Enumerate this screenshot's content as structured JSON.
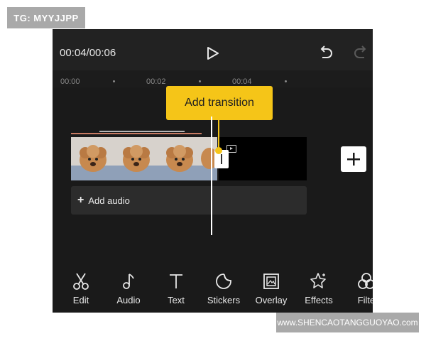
{
  "overlay_tag": "TG: MYYJJPP",
  "watermark": "www.SHENCAOTANGGUOYAO.com",
  "player": {
    "time": "00:04/00:06"
  },
  "ruler": {
    "ticks": [
      "00:00",
      "00:02",
      "00:04"
    ]
  },
  "tooltip": {
    "text": "Add transition"
  },
  "audio_track": {
    "label": "Add audio"
  },
  "toolbar": {
    "items": [
      {
        "label": "Edit",
        "icon": "scissors-icon"
      },
      {
        "label": "Audio",
        "icon": "music-note-icon"
      },
      {
        "label": "Text",
        "icon": "text-icon"
      },
      {
        "label": "Stickers",
        "icon": "sticker-icon"
      },
      {
        "label": "Overlay",
        "icon": "overlay-icon"
      },
      {
        "label": "Effects",
        "icon": "effects-icon"
      },
      {
        "label": "Filte",
        "icon": "filter-icon"
      }
    ]
  },
  "colors": {
    "accent": "#f5c518",
    "background": "#1a1a1a",
    "clip_marker": "#c77a62"
  }
}
